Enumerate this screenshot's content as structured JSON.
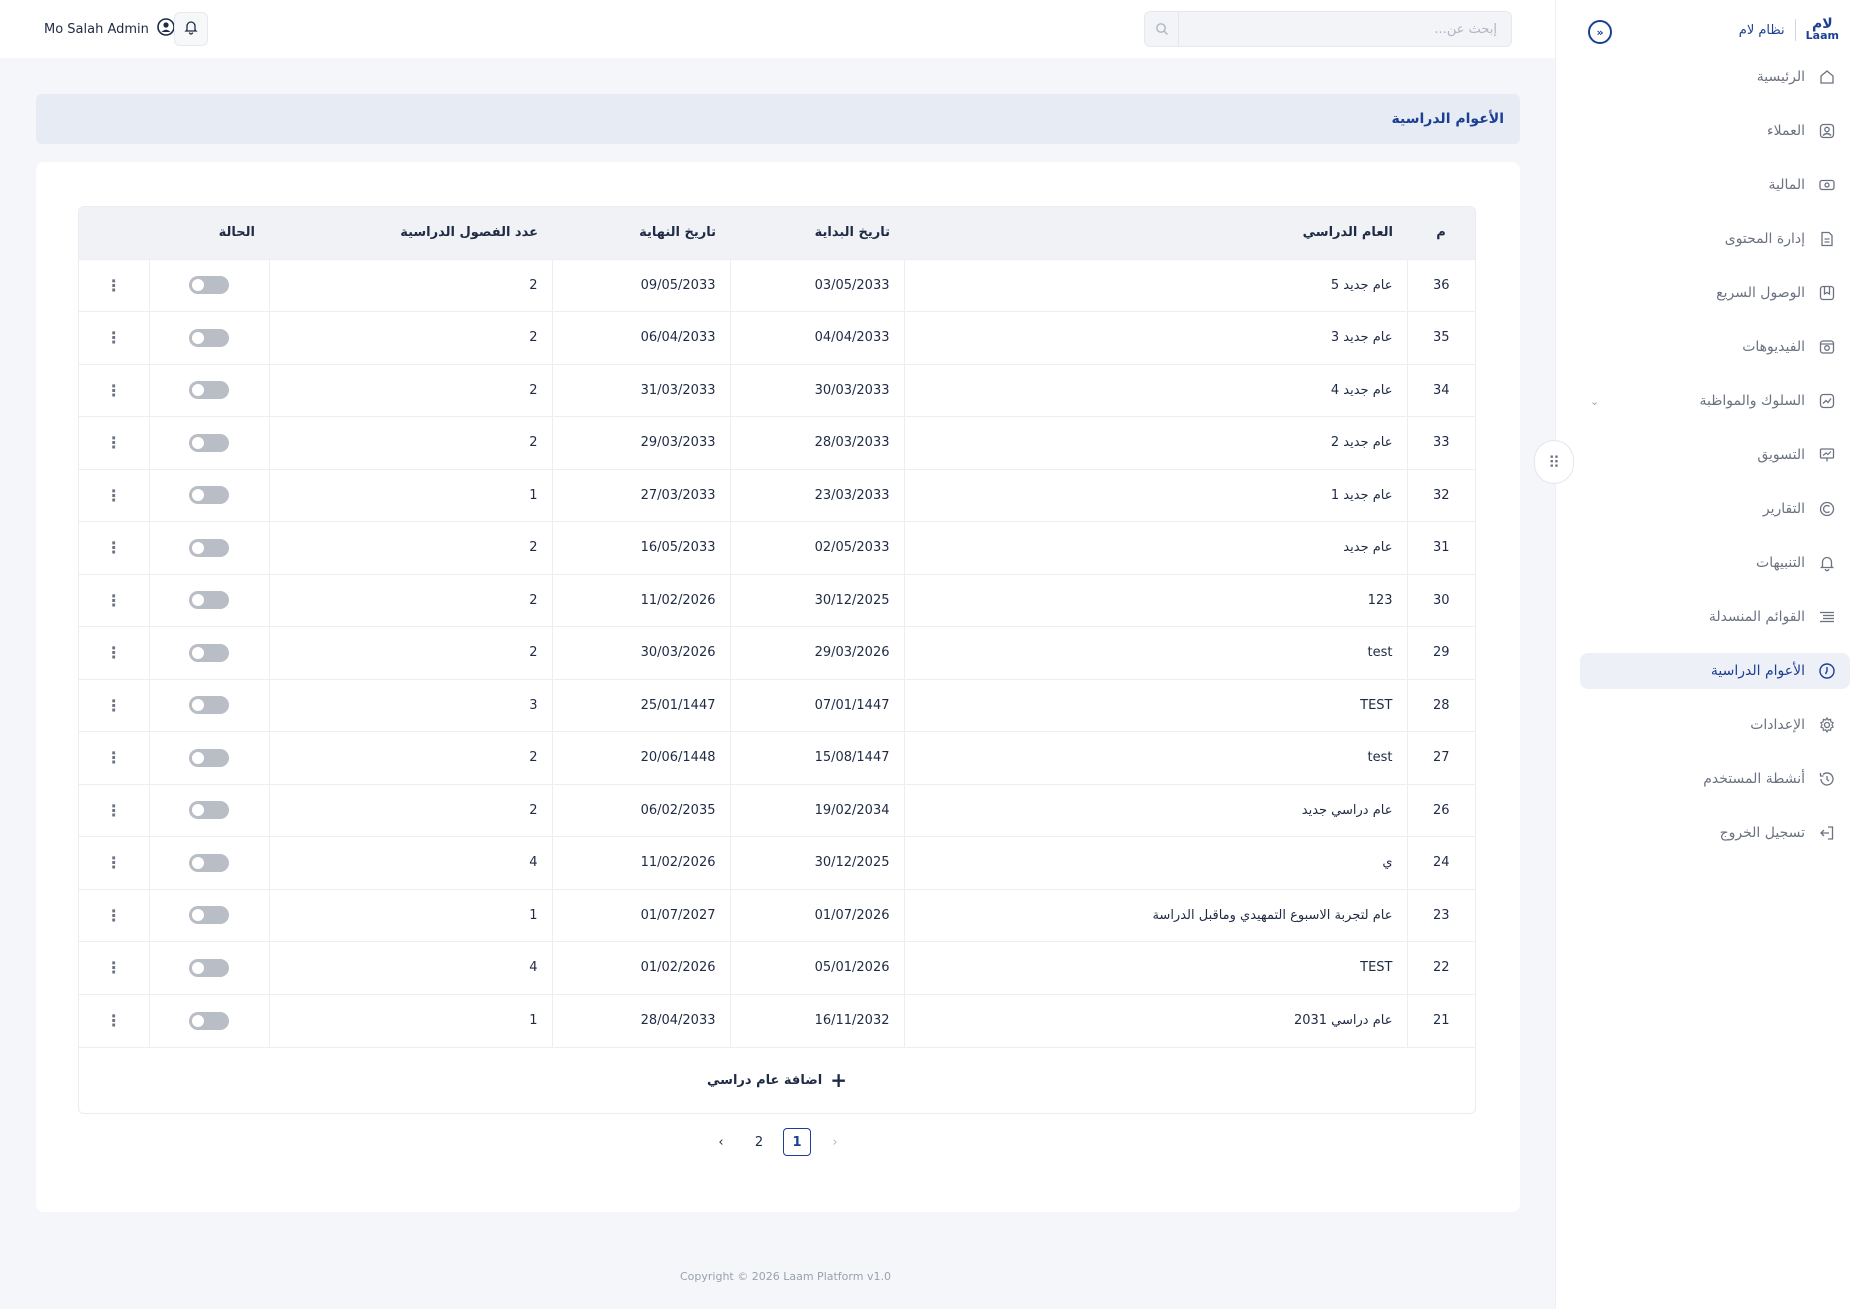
{
  "brand": {
    "logo_top": "لام",
    "logo_bottom": "Laam",
    "name": "نظام لام"
  },
  "topbar": {
    "search_placeholder": "إبحث عن...",
    "user_name": "Mo Salah Admin"
  },
  "sidebar": {
    "items": [
      {
        "label": "الرئيسية",
        "icon": "home-icon"
      },
      {
        "label": "العملاء",
        "icon": "user-icon"
      },
      {
        "label": "المالية",
        "icon": "money-icon"
      },
      {
        "label": "إدارة المحتوى",
        "icon": "document-icon"
      },
      {
        "label": "الوصول السريع",
        "icon": "bookmark-icon"
      },
      {
        "label": "الفيديوهات",
        "icon": "video-icon"
      },
      {
        "label": "السلوك والمواظبة",
        "icon": "trend-icon",
        "has_submenu": true
      },
      {
        "label": "التسويق",
        "icon": "presentation-icon"
      },
      {
        "label": "التقارير",
        "icon": "report-icon"
      },
      {
        "label": "التنبيهات",
        "icon": "bell-icon"
      },
      {
        "label": "القوائم المنسدلة",
        "icon": "list-icon"
      },
      {
        "label": "الأعوام الدراسية",
        "icon": "clock-icon",
        "active": true
      },
      {
        "label": "الإعدادات",
        "icon": "gear-icon"
      },
      {
        "label": "أنشطة المستخدم",
        "icon": "history-icon"
      },
      {
        "label": "تسجيل الخروج",
        "icon": "logout-icon"
      }
    ]
  },
  "page": {
    "title": "الأعوام الدراسية"
  },
  "table": {
    "headers": {
      "id": "م",
      "year": "العام الدراسي",
      "start": "تاريخ البداية",
      "end": "تاريخ النهاية",
      "terms": "عدد الفصول الدراسية",
      "status": "الحالة"
    },
    "rows": [
      {
        "id": "36",
        "year": "عام جديد 5",
        "start": "03/05/2033",
        "end": "09/05/2033",
        "terms": "2",
        "active": false
      },
      {
        "id": "35",
        "year": "عام جديد 3",
        "start": "04/04/2033",
        "end": "06/04/2033",
        "terms": "2",
        "active": false
      },
      {
        "id": "34",
        "year": "عام جديد 4",
        "start": "30/03/2033",
        "end": "31/03/2033",
        "terms": "2",
        "active": false
      },
      {
        "id": "33",
        "year": "عام جديد 2",
        "start": "28/03/2033",
        "end": "29/03/2033",
        "terms": "2",
        "active": false
      },
      {
        "id": "32",
        "year": "عام جديد 1",
        "start": "23/03/2033",
        "end": "27/03/2033",
        "terms": "1",
        "active": false
      },
      {
        "id": "31",
        "year": "عام جديد",
        "start": "02/05/2033",
        "end": "16/05/2033",
        "terms": "2",
        "active": false
      },
      {
        "id": "30",
        "year": "123",
        "start": "30/12/2025",
        "end": "11/02/2026",
        "terms": "2",
        "active": false
      },
      {
        "id": "29",
        "year": "test",
        "start": "29/03/2026",
        "end": "30/03/2026",
        "terms": "2",
        "active": false
      },
      {
        "id": "28",
        "year": "TEST",
        "start": "07/01/1447",
        "end": "25/01/1447",
        "terms": "3",
        "active": false
      },
      {
        "id": "27",
        "year": "test",
        "start": "15/08/1447",
        "end": "20/06/1448",
        "terms": "2",
        "active": false
      },
      {
        "id": "26",
        "year": "عام دراسي جديد",
        "start": "19/02/2034",
        "end": "06/02/2035",
        "terms": "2",
        "active": false
      },
      {
        "id": "24",
        "year": "ي",
        "start": "30/12/2025",
        "end": "11/02/2026",
        "terms": "4",
        "active": false
      },
      {
        "id": "23",
        "year": "عام لتجربة الاسبوع التمهيدي وماقبل الدراسة",
        "start": "01/07/2026",
        "end": "01/07/2027",
        "terms": "1",
        "active": false
      },
      {
        "id": "22",
        "year": "TEST",
        "start": "05/01/2026",
        "end": "01/02/2026",
        "terms": "4",
        "active": false
      },
      {
        "id": "21",
        "year": "عام دراسي 2031",
        "start": "16/11/2032",
        "end": "28/04/2033",
        "terms": "1",
        "active": false
      }
    ],
    "add_label": "اضافة عام دراسي"
  },
  "pagination": {
    "pages": [
      "1",
      "2"
    ],
    "current": "1"
  },
  "footer": {
    "copyright": "Copyright © 2026 Laam Platform v1.0"
  },
  "colors": {
    "primary": "#1c3f94",
    "toggle_off": "#b9bdc5",
    "active_bg": "#edf0f7"
  }
}
